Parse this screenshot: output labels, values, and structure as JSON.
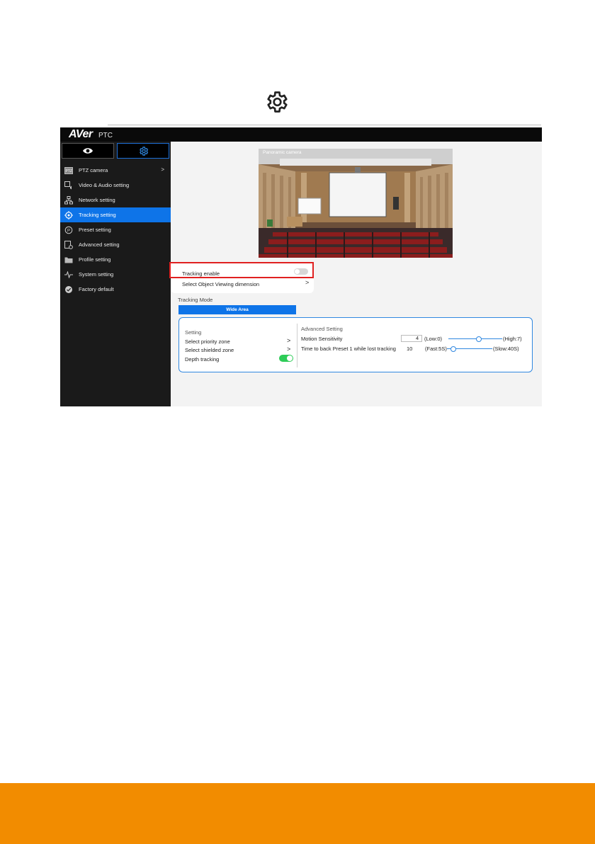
{
  "document": {
    "gear_icon": "gear-icon"
  },
  "app": {
    "brand": "AVer",
    "product": "PTC",
    "sidebar": {
      "tabs": [
        {
          "icon": "eye-icon"
        },
        {
          "icon": "gear-icon"
        }
      ],
      "items": [
        {
          "label": "PTZ camera",
          "icon": "ptz-icon",
          "chevron": ">"
        },
        {
          "label": "Video & Audio setting",
          "icon": "video-audio-icon"
        },
        {
          "label": "Network setting",
          "icon": "network-icon"
        },
        {
          "label": "Tracking setting",
          "icon": "tracking-icon",
          "active": true
        },
        {
          "label": "Preset setting",
          "icon": "preset-icon"
        },
        {
          "label": "Advanced setting",
          "icon": "advanced-icon"
        },
        {
          "label": "Profile setting",
          "icon": "folder-icon"
        },
        {
          "label": "System setting",
          "icon": "pulse-icon"
        },
        {
          "label": "Factory default",
          "icon": "check-badge-icon"
        }
      ]
    },
    "main": {
      "camera_label": "Panoramic camera",
      "tracking_enable_label": "Tracking enable",
      "select_object_label": "Select Object Viewing dimension",
      "select_object_chevron": ">",
      "tracking_mode_label": "Tracking Mode",
      "tracking_mode_value": "Wide Area",
      "setting_panel": {
        "header": "Setting",
        "priority_zone": "Select priority zone",
        "shielded_zone": "Select shielded zone",
        "depth_tracking": "Depth tracking",
        "chevron": ">"
      },
      "advanced_panel": {
        "header": "Advanced Setting",
        "motion_label": "Motion Sensitivity",
        "motion_value": "4",
        "motion_low": "(Low:0)",
        "motion_high": "(High:7)",
        "motion_level": 0.57,
        "back_label": "Time to back Preset 1 while lost tracking",
        "back_value": "10",
        "back_fast": "(Fast:5S)",
        "back_slow": "(Slow:40S)",
        "back_level": 0.14
      }
    }
  },
  "colors": {
    "accent": "#0e74e8",
    "highlight": "#e02020",
    "footer": "#f28c00",
    "toggle_on": "#2ecc58"
  }
}
